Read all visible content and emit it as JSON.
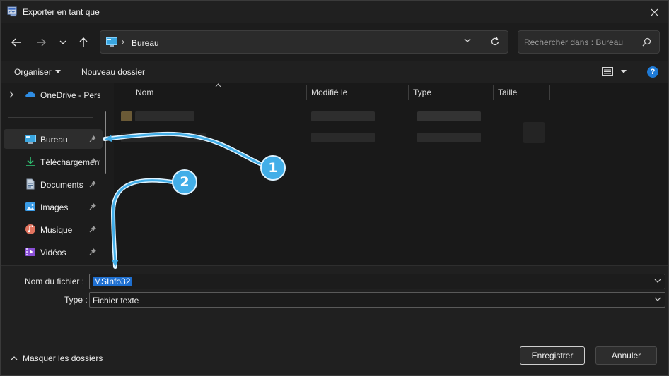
{
  "window": {
    "title": "Exporter en tant que",
    "accent": "#1e6fd0"
  },
  "nav": {
    "back_icon": "arrow-left-icon",
    "forward_icon": "arrow-right-icon",
    "recent_icon": "chevron-down-icon",
    "up_icon": "arrow-up-icon",
    "address": {
      "location": "Bureau"
    },
    "search": {
      "placeholder": "Rechercher dans : Bureau"
    }
  },
  "toolbar": {
    "organize_label": "Organiser",
    "new_folder_label": "Nouveau dossier",
    "help_label": "?"
  },
  "sidebar": {
    "items": [
      {
        "label": "OneDrive - Personnel",
        "icon": "cloud-icon"
      },
      {
        "label": "Bureau",
        "icon": "desktop-icon",
        "pinned": true,
        "selected": true
      },
      {
        "label": "Téléchargements",
        "icon": "download-icon",
        "pinned": true
      },
      {
        "label": "Documents",
        "icon": "document-icon",
        "pinned": true
      },
      {
        "label": "Images",
        "icon": "image-icon",
        "pinned": true
      },
      {
        "label": "Musique",
        "icon": "music-icon",
        "pinned": true
      },
      {
        "label": "Vidéos",
        "icon": "video-icon",
        "pinned": true
      }
    ]
  },
  "filelist": {
    "columns": [
      "Nom",
      "Modifié le",
      "Type",
      "Taille"
    ]
  },
  "form": {
    "filename_label": "Nom du fichier :",
    "filename_value": "MSInfo32",
    "type_label": "Type :",
    "type_value": "Fichier texte"
  },
  "footer": {
    "hide_folders_label": "Masquer les dossiers",
    "save_label": "Enregistrer",
    "cancel_label": "Annuler"
  },
  "annotations": {
    "badge_1": "1",
    "badge_2": "2",
    "color": "#42aee8"
  }
}
